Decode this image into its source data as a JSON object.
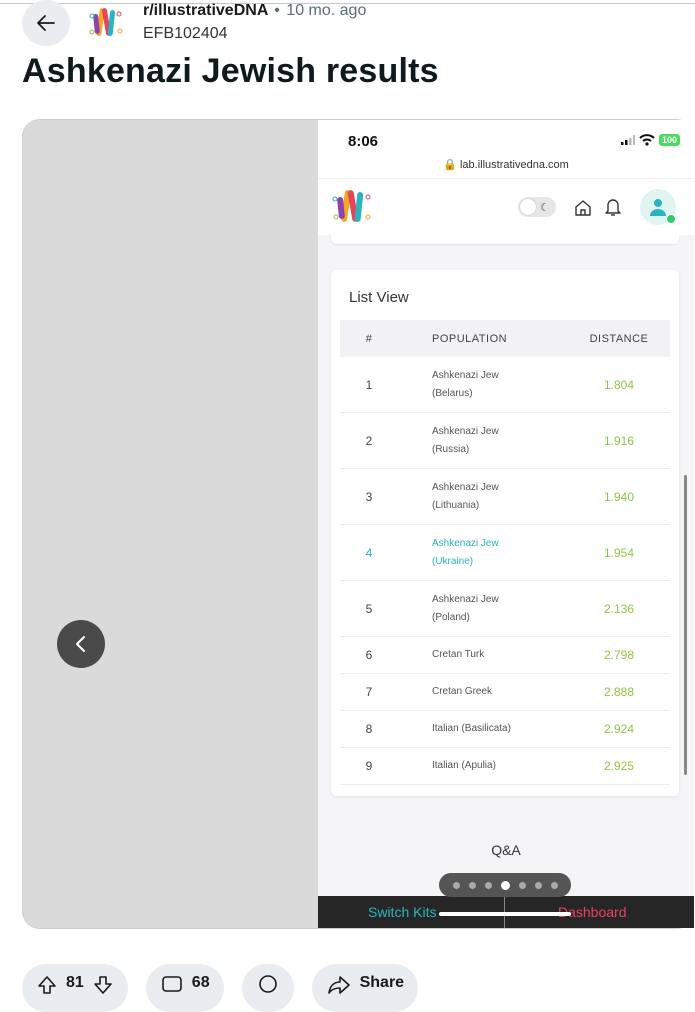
{
  "post": {
    "subreddit": "r/illustrativeDNA",
    "separator": "•",
    "age": "10 mo. ago",
    "author": "EFB102404",
    "title": "Ashkenazi Jewish results"
  },
  "phone": {
    "time": "8:06",
    "url": "lab.illustrativedna.com",
    "battery": "100",
    "list_title": "List View",
    "columns": {
      "num": "#",
      "population": "POPULATION",
      "distance": "DISTANCE"
    },
    "rows": [
      {
        "num": "1",
        "pop1": "Ashkenazi Jew",
        "pop2": "(Belarus)",
        "dist": "1.804"
      },
      {
        "num": "2",
        "pop1": "Ashkenazi Jew",
        "pop2": "(Russia)",
        "dist": "1.916"
      },
      {
        "num": "3",
        "pop1": "Ashkenazi Jew",
        "pop2": "(Lithuania)",
        "dist": "1.940"
      },
      {
        "num": "4",
        "pop1": "Ashkenazi Jew",
        "pop2": "(Ukraine)",
        "dist": "1.954"
      },
      {
        "num": "5",
        "pop1": "Ashkenazi Jew",
        "pop2": "(Poland)",
        "dist": "2.136"
      },
      {
        "num": "6",
        "pop1": "Cretan Turk",
        "dist": "2.798"
      },
      {
        "num": "7",
        "pop1": "Cretan Greek",
        "dist": "2.888"
      },
      {
        "num": "8",
        "pop1": "Italian (Basilicata)",
        "dist": "2.924"
      },
      {
        "num": "9",
        "pop1": "Italian (Apulia)",
        "dist": "2.925"
      }
    ],
    "qa": "Q&A",
    "switch_kits": "Switch Kits",
    "dashboard": "Dashboard"
  },
  "gallery": {
    "image_count": 7,
    "active_index": 4
  },
  "actions": {
    "upvotes": "81",
    "comments": "68",
    "share": "Share"
  },
  "colors": {
    "distance": "#8dc63f",
    "highlight": "#2ab3c0",
    "dashboard": "#e5445d"
  }
}
